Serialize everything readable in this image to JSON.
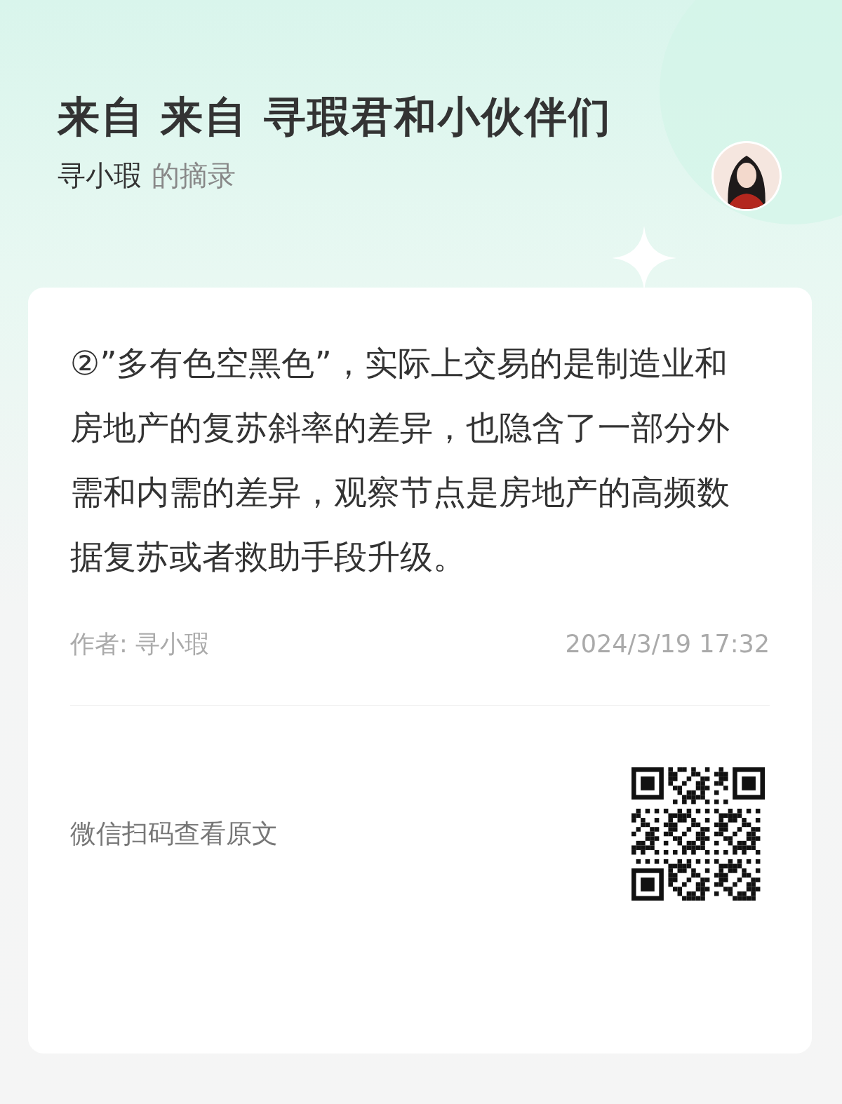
{
  "header": {
    "title": "来自 来自 寻瑕君和小伙伴们",
    "author": "寻小瑕",
    "suffix": "的摘录"
  },
  "excerpt": {
    "text": "②”多有色空黑色”，实际上交易的是制造业和房地产的复苏斜率的差异，也隐含了一部分外需和内需的差异，观察节点是房地产的高频数据复苏或者救助手段升级。"
  },
  "meta": {
    "author": "作者: 寻小瑕",
    "date": "2024/3/19 17:32"
  },
  "footer": {
    "cta": "微信扫码查看原文"
  }
}
